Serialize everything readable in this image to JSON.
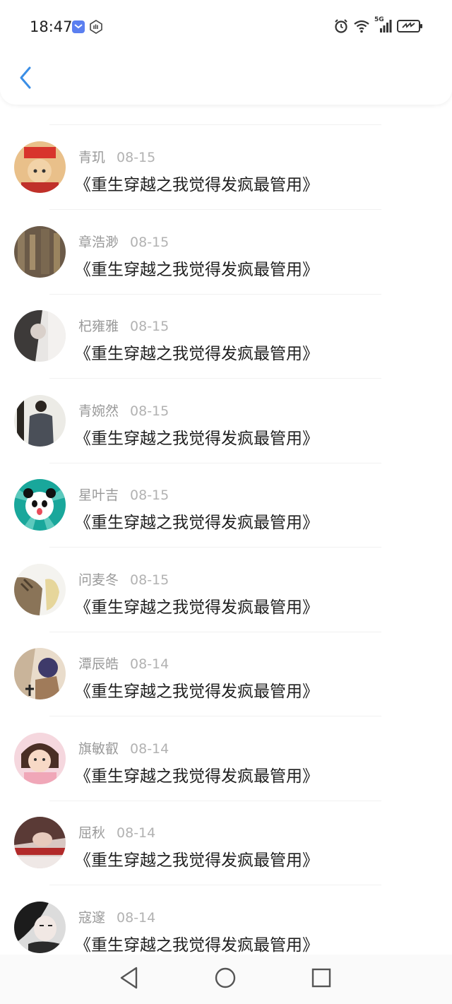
{
  "status_bar": {
    "time": "18:47",
    "network": "5G",
    "icons": [
      "blue-app-notification-icon",
      "hand-notification-icon",
      "alarm-icon",
      "wifi-icon",
      "cellular-signal-icon",
      "battery-charging-icon"
    ]
  },
  "header": {
    "back_icon": "chevron-left-icon",
    "accent": "#3a8ee6"
  },
  "comments": [
    {
      "name": "青玑",
      "date": "08-15",
      "text": "《重生穿越之我觉得发疯最管用》"
    },
    {
      "name": "章浩渺",
      "date": "08-15",
      "text": "《重生穿越之我觉得发疯最管用》"
    },
    {
      "name": "杞雍雅",
      "date": "08-15",
      "text": "《重生穿越之我觉得发疯最管用》"
    },
    {
      "name": "青婉然",
      "date": "08-15",
      "text": "《重生穿越之我觉得发疯最管用》"
    },
    {
      "name": "星叶吉",
      "date": "08-15",
      "text": "《重生穿越之我觉得发疯最管用》"
    },
    {
      "name": "问麦冬",
      "date": "08-15",
      "text": "《重生穿越之我觉得发疯最管用》"
    },
    {
      "name": "潭辰皓",
      "date": "08-14",
      "text": "《重生穿越之我觉得发疯最管用》"
    },
    {
      "name": "旗敏叡",
      "date": "08-14",
      "text": "《重生穿越之我觉得发疯最管用》"
    },
    {
      "name": "屈秋",
      "date": "08-14",
      "text": "《重生穿越之我觉得发疯最管用》"
    },
    {
      "name": "寇邃",
      "date": "08-14",
      "text": "《重生穿越之我觉得发疯最管用》"
    }
  ],
  "nav_bar": {
    "back": "triangle-back-icon",
    "home": "circle-home-icon",
    "recents": "square-recents-icon"
  }
}
